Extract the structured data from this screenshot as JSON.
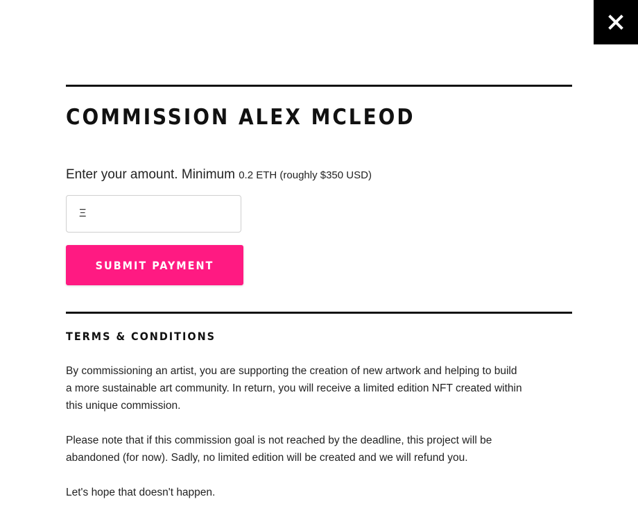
{
  "close_button": {
    "icon": "close-icon",
    "bg": "#000000"
  },
  "commission": {
    "title": "COMMISSION ALEX MCLEOD",
    "amount_prompt": "Enter your amount. Minimum",
    "minimum_value": "0.2 ETH (roughly $350 USD)",
    "input": {
      "currency_symbol": "Ξ",
      "value": "",
      "placeholder": ""
    },
    "submit_label": "SUBMIT PAYMENT",
    "accent_color": "#ff1a82"
  },
  "terms": {
    "heading": "TERMS & CONDITIONS",
    "paragraphs": [
      "By commissioning an artist, you are supporting the creation of new artwork and helping to build a more sustainable art community. In return, you will receive a limited edition NFT created within this unique commission.",
      "Please note that if this commission goal is not reached by the deadline, this project will be abandoned (for now). Sadly, no limited edition will be created and we will refund you.",
      "Let's hope that doesn't happen."
    ]
  }
}
